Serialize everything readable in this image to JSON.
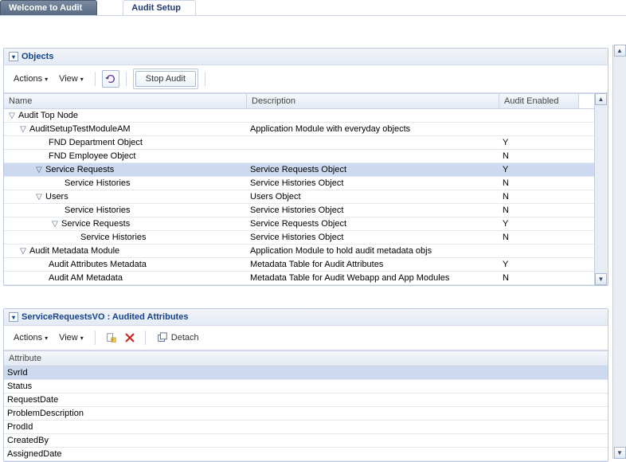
{
  "tabs": {
    "welcome": "Welcome to Audit",
    "setup": "Audit Setup"
  },
  "objects": {
    "title": "Objects",
    "actions": "Actions",
    "view": "View",
    "stop_audit": "Stop Audit",
    "col_name": "Name",
    "col_desc": "Description",
    "col_enabled": "Audit Enabled",
    "rows": [
      {
        "name": "Audit Top Node",
        "desc": "",
        "enabled": "",
        "indent": 0,
        "exp": true
      },
      {
        "name": "AuditSetupTestModuleAM",
        "desc": "Application Module with everyday objects",
        "enabled": "",
        "indent": 1,
        "exp": true
      },
      {
        "name": "FND Department Object",
        "desc": "",
        "enabled": "Y",
        "indent": 2,
        "exp": false
      },
      {
        "name": "FND Employee Object",
        "desc": "",
        "enabled": "N",
        "indent": 2,
        "exp": false
      },
      {
        "name": "Service Requests",
        "desc": "Service Requests Object",
        "enabled": "Y",
        "indent": 2,
        "exp": true,
        "selected": true
      },
      {
        "name": "Service Histories",
        "desc": "Service Histories Object",
        "enabled": "N",
        "indent": 3,
        "exp": false
      },
      {
        "name": "Users",
        "desc": "Users Object",
        "enabled": "N",
        "indent": 2,
        "exp": true
      },
      {
        "name": "Service Histories",
        "desc": "Service Histories Object",
        "enabled": "N",
        "indent": 3,
        "exp": false
      },
      {
        "name": "Service Requests",
        "desc": "Service Requests Object",
        "enabled": "Y",
        "indent": 3,
        "exp": true
      },
      {
        "name": "Service Histories",
        "desc": "Service Histories Object",
        "enabled": "N",
        "indent": 4,
        "exp": false
      },
      {
        "name": "Audit Metadata Module",
        "desc": "Application Module to hold audit metadata objs",
        "enabled": "",
        "indent": 1,
        "exp": true
      },
      {
        "name": "Audit Attributes Metadata",
        "desc": "Metadata Table for Audit Attributes",
        "enabled": "Y",
        "indent": 2,
        "exp": false
      },
      {
        "name": "Audit AM Metadata",
        "desc": "Metadata Table for Audit Webapp and App Modules",
        "enabled": "N",
        "indent": 2,
        "exp": false
      }
    ]
  },
  "attributes": {
    "title": "ServiceRequestsVO : Audited Attributes",
    "actions": "Actions",
    "view": "View",
    "detach": "Detach",
    "col_attr": "Attribute",
    "rows": [
      {
        "name": "SvrId",
        "selected": true
      },
      {
        "name": "Status"
      },
      {
        "name": "RequestDate"
      },
      {
        "name": "ProblemDescription"
      },
      {
        "name": "ProdId"
      },
      {
        "name": "CreatedBy"
      },
      {
        "name": "AssignedDate"
      }
    ]
  }
}
